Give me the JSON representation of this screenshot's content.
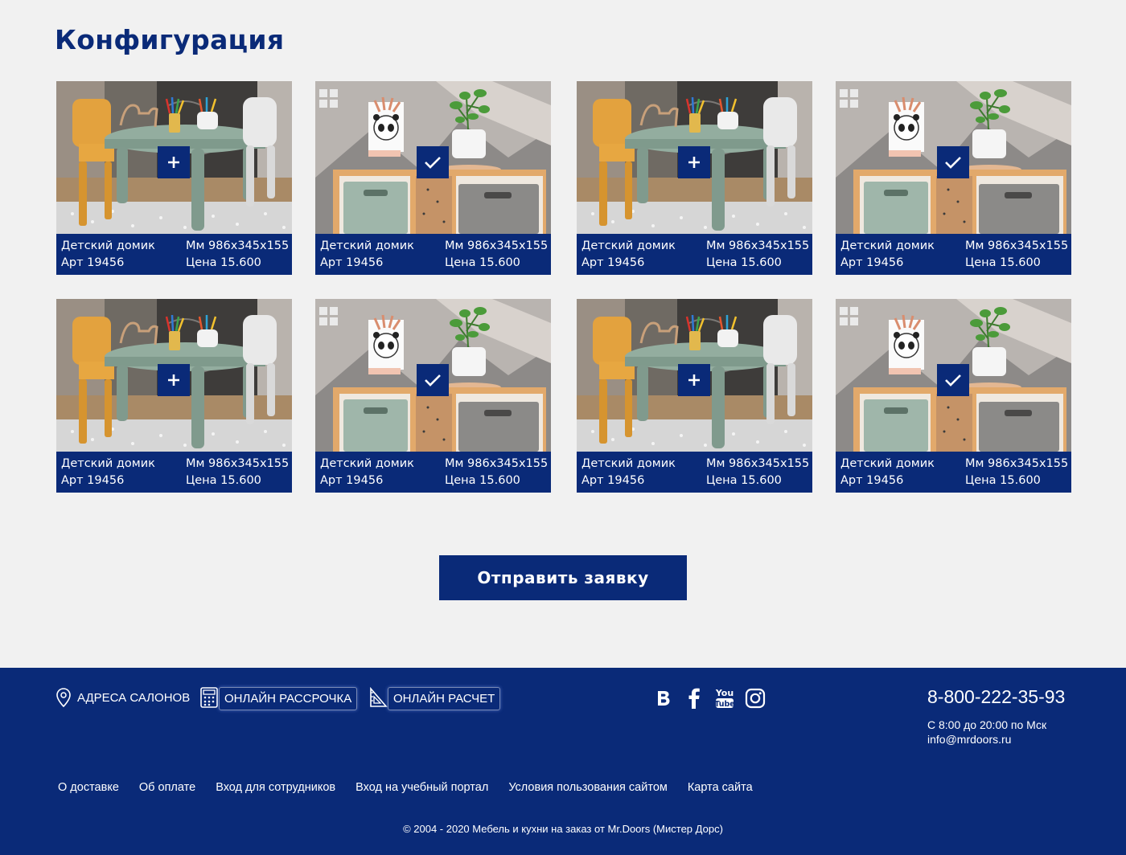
{
  "page": {
    "title": "Конфигурация",
    "submit_label": "Отправить заявку"
  },
  "colors": {
    "brand": "#0a2a78",
    "background": "#f1f1f1"
  },
  "products": [
    {
      "name": "Детский домик",
      "size": "Мм 986x345x155",
      "art": "Арт 19456",
      "price": "Цена 15.600",
      "image": "kids-table-chairs",
      "state": "add",
      "badge_icon": "plus-icon"
    },
    {
      "name": "Детский домик",
      "size": "Мм 986x345x155",
      "art": "Арт 19456",
      "price": "Цена 15.600",
      "image": "kids-shelf-panda",
      "state": "selected",
      "badge_icon": "check-icon"
    },
    {
      "name": "Детский домик",
      "size": "Мм 986x345x155",
      "art": "Арт 19456",
      "price": "Цена 15.600",
      "image": "kids-table-chairs",
      "state": "add",
      "badge_icon": "plus-icon"
    },
    {
      "name": "Детский домик",
      "size": "Мм 986x345x155",
      "art": "Арт 19456",
      "price": "Цена 15.600",
      "image": "kids-shelf-panda",
      "state": "selected",
      "badge_icon": "check-icon"
    },
    {
      "name": "Детский домик",
      "size": "Мм 986x345x155",
      "art": "Арт 19456",
      "price": "Цена 15.600",
      "image": "kids-table-chairs",
      "state": "add",
      "badge_icon": "plus-icon"
    },
    {
      "name": "Детский домик",
      "size": "Мм 986x345x155",
      "art": "Арт 19456",
      "price": "Цена 15.600",
      "image": "kids-shelf-panda",
      "state": "selected",
      "badge_icon": "check-icon"
    },
    {
      "name": "Детский домик",
      "size": "Мм 986x345x155",
      "art": "Арт 19456",
      "price": "Цена 15.600",
      "image": "kids-table-chairs",
      "state": "add",
      "badge_icon": "plus-icon"
    },
    {
      "name": "Детский домик",
      "size": "Мм 986x345x155",
      "art": "Арт 19456",
      "price": "Цена 15.600",
      "image": "kids-shelf-panda",
      "state": "selected",
      "badge_icon": "check-icon"
    }
  ],
  "footer": {
    "addresses": {
      "label": "АДРЕСА САЛОНОВ",
      "icon": "location-pin-icon"
    },
    "installment": {
      "label": "ОНЛАЙН РАССРОЧКА",
      "icon": "calculator-icon"
    },
    "calculation": {
      "label": "ОНЛАЙН РАСЧЕТ",
      "icon": "ruler-icon"
    },
    "social": [
      "vk-icon",
      "facebook-icon",
      "youtube-icon",
      "instagram-icon"
    ],
    "phone": "8-800-222-35-93",
    "hours": "С 8:00 до 20:00 по Мск",
    "email": "info@mrdoors.ru",
    "links": [
      "О доставке",
      "Об оплате",
      "Вход для сотрудников",
      "Вход на учебный портал",
      "Условия пользования сайтом",
      "Карта сайта"
    ],
    "copyright": "© 2004 - 2020 Мебель и кухни на заказ от Mr.Doors (Мистер Дорс)"
  }
}
